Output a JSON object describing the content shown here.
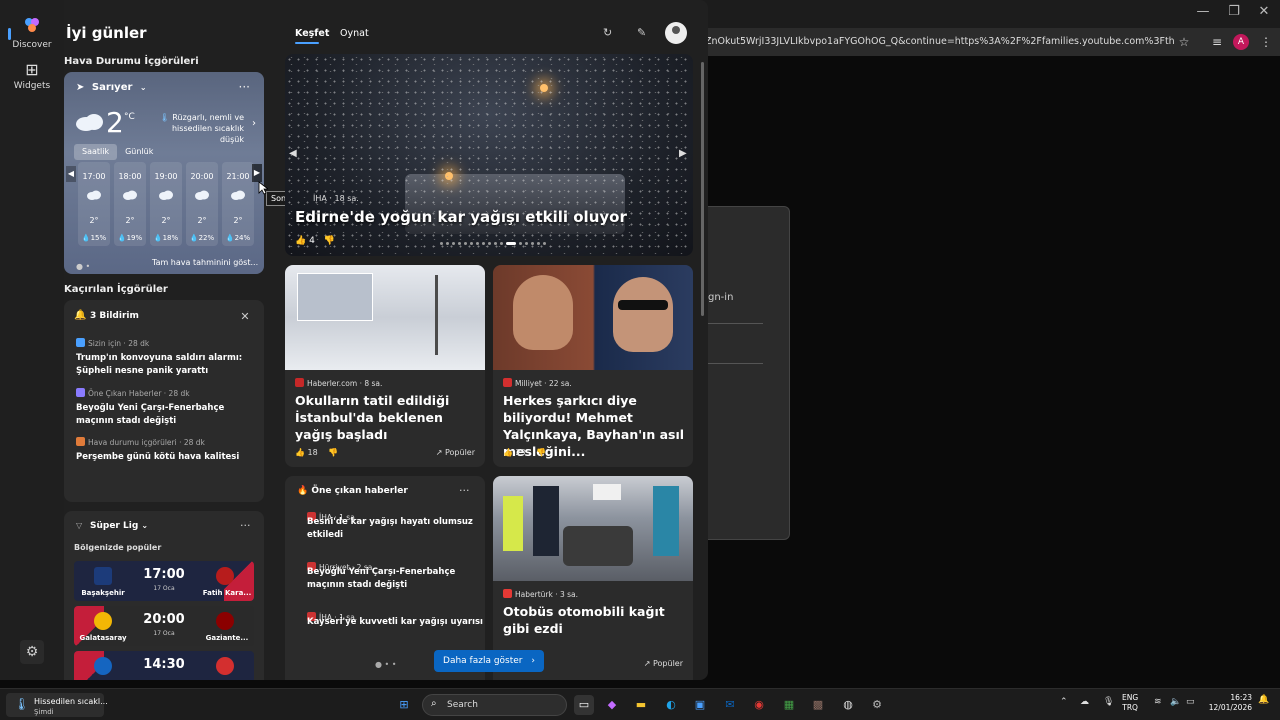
{
  "browser": {
    "address": "ZnOkut5WrjI33JLVLIkbvpo1aFYGOhOG_Q&continue=https%3A%2F%2Ffamilies.youtube.com%3Ftheme%3Dda...",
    "avatar_letter": "A",
    "signin_text": "gn-in",
    "controls": {
      "minimize": "—",
      "maximize": "❐",
      "close": "✕"
    }
  },
  "rail": {
    "discover_label": "Discover",
    "widgets_label": "Widgets"
  },
  "greeting": "İyi günler",
  "feed_tabs": [
    {
      "label": "Keşfet"
    },
    {
      "label": "Oynat"
    }
  ],
  "weather": {
    "section_title": "Hava Durumu İçgörüleri",
    "location": "Sarıyer",
    "temp": "2",
    "unit": "°C",
    "description": "Rüzgarlı, nemli ve hissedilen sıcaklık düşük",
    "tabs": [
      "Saatlik",
      "Günlük"
    ],
    "hours": [
      {
        "time": "17:00",
        "temp": "2°",
        "precip": "💧15%"
      },
      {
        "time": "18:00",
        "temp": "2°",
        "precip": "💧19%"
      },
      {
        "time": "19:00",
        "temp": "2°",
        "precip": "💧18%"
      },
      {
        "time": "20:00",
        "temp": "2°",
        "precip": "💧22%"
      },
      {
        "time": "21:00",
        "temp": "2°",
        "precip": "💧24%"
      }
    ],
    "forecast_link": "Tam hava tahminini göst...",
    "tooltip": "Sonraki"
  },
  "missed": {
    "section_title": "Kaçırılan İçgörüler",
    "count_label": "3 Bildirim",
    "items": [
      {
        "source": "Sizin için · 28 dk",
        "title": "Trump'ın konvoyuna saldırı alarmı: Şüpheli nesne panik yarattı",
        "color": "#4aa0ff"
      },
      {
        "source": "Öne Çıkan Haberler · 28 dk",
        "title": "Beyoğlu Yeni Çarşı-Fenerbahçe maçının stadı değişti",
        "color": "#8a7bff"
      },
      {
        "source": "Hava durumu içgörüleri · 28 dk",
        "title": "Perşembe günü kötü hava kalitesi",
        "color": "#e07b3a"
      }
    ]
  },
  "league": {
    "name": "Süper Lig",
    "subtitle": "Bölgenizde popüler",
    "matches": [
      {
        "home": "Başakşehir",
        "away": "Fatih Kara...",
        "time": "17:00",
        "date": "17 Oca"
      },
      {
        "home": "Galatasaray",
        "away": "Gaziante...",
        "time": "20:00",
        "date": "17 Oca"
      },
      {
        "home": "",
        "away": "",
        "time": "14:30",
        "date": ""
      }
    ]
  },
  "hero": {
    "source": "İHA · 18 sa.",
    "title": "Edirne'de yoğun kar yağışı etkili oluyor",
    "likes": "4"
  },
  "cards": [
    {
      "source": "Haberler.com · 8 sa.",
      "title": "Okulların tatil edildiği İstanbul'da beklenen yağış başladı",
      "likes": "18",
      "tag": "Popüler"
    },
    {
      "source": "Milliyet · 22 sa.",
      "title": "Herkes şarkıcı diye biliyordu! Mehmet Yalçınkaya, Bayhan'ın asıl mesleğini...",
      "likes": "23"
    },
    {
      "source": "Habertürk · 3 sa.",
      "title": "Otobüs otomobili kağıt gibi ezdi",
      "tag": "Popüler"
    }
  ],
  "trending": {
    "title": "Öne çıkan haberler",
    "items": [
      {
        "source": "İHA · 1 sa.",
        "title": "Besni'de kar yağışı hayatı olumsuz etkiledi"
      },
      {
        "source": "Hürriyet · 2 sa.",
        "title": "Beyoğlu Yeni Çarşı-Fenerbahçe maçının stadı değişti"
      },
      {
        "source": "İHA · 1 sa.",
        "title": "Kayseri'ye kuvvetli kar yağışı uyarısı"
      }
    ]
  },
  "more_button": "Daha fazla göster",
  "taskbar": {
    "weather_line1": "Hissedilen sıcakl...",
    "weather_line2": "Şimdi",
    "search_label": "Search",
    "lang1": "ENG",
    "lang2": "TRQ",
    "time": "16:23",
    "date": "12/01/2026"
  }
}
